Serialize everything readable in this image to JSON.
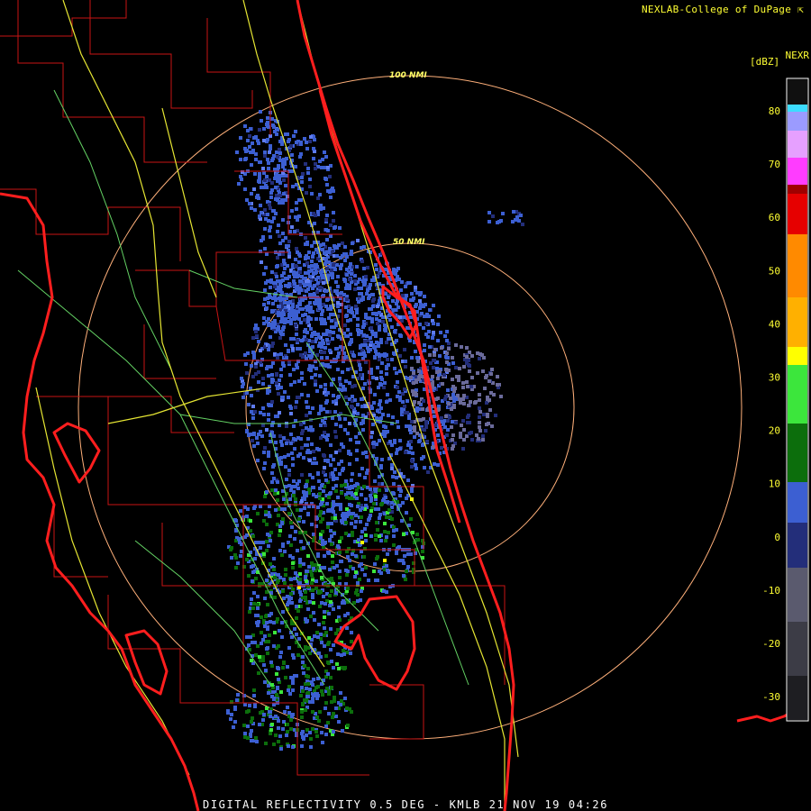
{
  "header": {
    "credit": "NEXLAB-College of DuPage ⇱",
    "product": "NEXR",
    "units": "[dBZ]"
  },
  "footer": {
    "title": "DIGITAL REFLECTIVITY 0.5 DEG - KMLB 21 NOV 19 04:26"
  },
  "range_rings": [
    {
      "label": "100 NMI",
      "radius_nmi": 100
    },
    {
      "label": "50 NMI",
      "radius_nmi": 50
    }
  ],
  "color_scale": {
    "ticks": [
      "80",
      "70",
      "60",
      "50",
      "40",
      "30",
      "20",
      "10",
      "0",
      "-10",
      "-20",
      "-30"
    ],
    "colors": {
      "gray": "#5a5a6e",
      "navy": "#232e7a",
      "blue": "#3c5fd2",
      "darkgreen": "#0c6e0c",
      "green": "#3ce63c",
      "yellow": "#ffff00",
      "orange": "#ff8a00",
      "red": "#e60000",
      "magenta": "#ff3cff",
      "cyan": "#3cdcff"
    }
  },
  "map_colors": {
    "coast": "#ff1e1e",
    "county": "#c81414",
    "highway": "#e6e633",
    "road": "#64d264",
    "ring": "#ffb07a"
  }
}
